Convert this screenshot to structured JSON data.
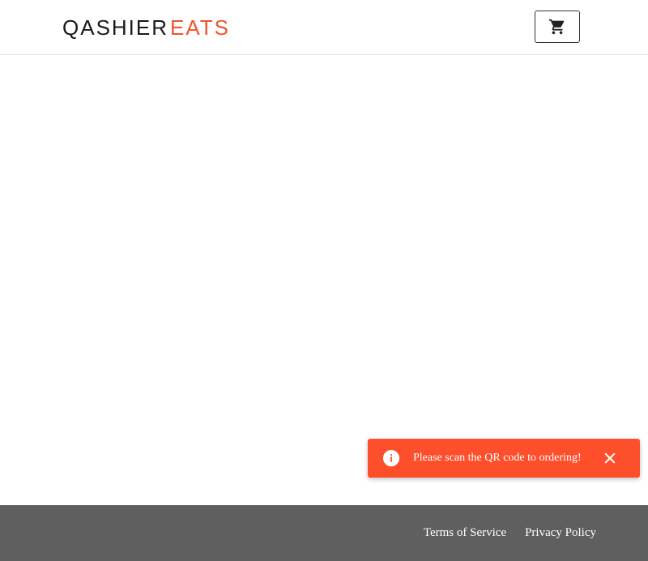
{
  "header": {
    "logo": {
      "primary": "QASHIER",
      "accent": "EATS"
    },
    "cart_icon": "shopping-cart-icon"
  },
  "toast": {
    "icon": "info-icon",
    "message": "Please scan the QR code to ordering!",
    "close_icon": "close-icon",
    "color": "#fd4f2b"
  },
  "footer": {
    "links": [
      {
        "label": "Terms of Service"
      },
      {
        "label": "Privacy Policy"
      }
    ],
    "color": "#5f5f5f"
  },
  "colors": {
    "brand_accent": "#f0532d",
    "logo_primary": "#1a1a1a"
  }
}
